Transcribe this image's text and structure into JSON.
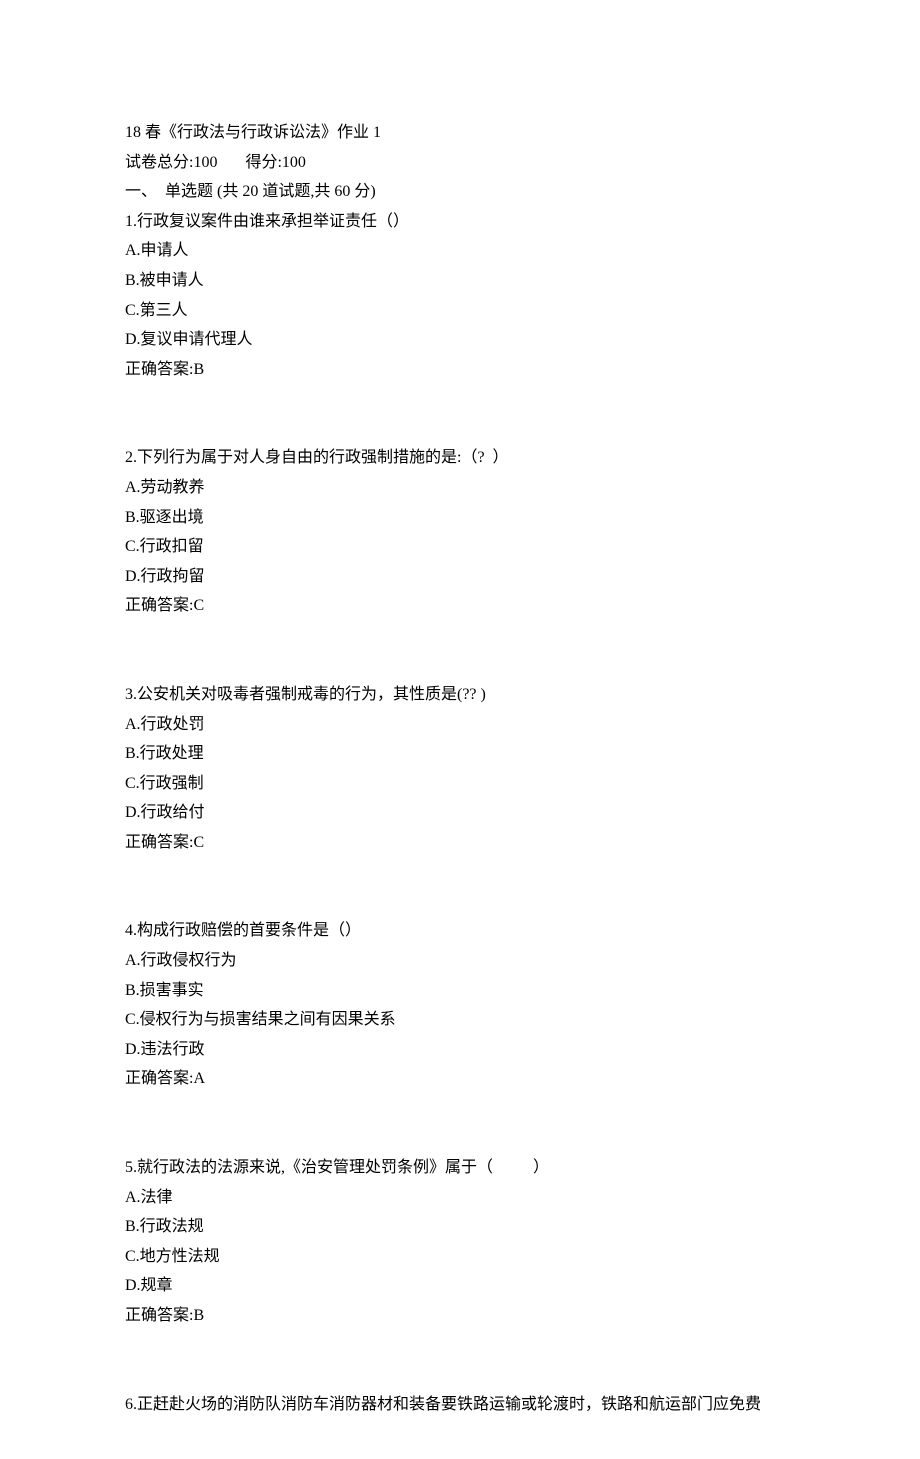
{
  "header": {
    "title": "18 春《行政法与行政诉讼法》作业 1",
    "total_line": "试卷总分:100       得分:100",
    "section_line": "一、  单选题 (共 20 道试题,共 60 分)"
  },
  "questions": [
    {
      "stem": "1.行政复议案件由谁来承担举证责任（）",
      "options": [
        "A.申请人",
        "B.被申请人",
        "C.第三人",
        "D.复议申请代理人"
      ],
      "answer": "正确答案:B"
    },
    {
      "stem": "2.下列行为属于对人身自由的行政强制措施的是:（?  ）",
      "options": [
        "A.劳动教养",
        "B.驱逐出境",
        "C.行政扣留",
        "D.行政拘留"
      ],
      "answer": "正确答案:C"
    },
    {
      "stem": "3.公安机关对吸毒者强制戒毒的行为，其性质是(?? )",
      "options": [
        "A.行政处罚",
        "B.行政处理",
        "C.行政强制",
        "D.行政给付"
      ],
      "answer": "正确答案:C"
    },
    {
      "stem": "4.构成行政赔偿的首要条件是（）",
      "options": [
        "A.行政侵权行为",
        "B.损害事实",
        "C.侵权行为与损害结果之间有因果关系",
        "D.违法行政"
      ],
      "answer": "正确答案:A"
    },
    {
      "stem": "5.就行政法的法源来说,《治安管理处罚条例》属于（          ）",
      "options": [
        "A.法律",
        "B.行政法规",
        "C.地方性法规",
        "D.规章"
      ],
      "answer": "正确答案:B"
    },
    {
      "stem": "6.正赶赴火场的消防队消防车消防器材和装备要铁路运输或轮渡时，铁路和航运部门应免费",
      "options": [],
      "answer": ""
    }
  ]
}
